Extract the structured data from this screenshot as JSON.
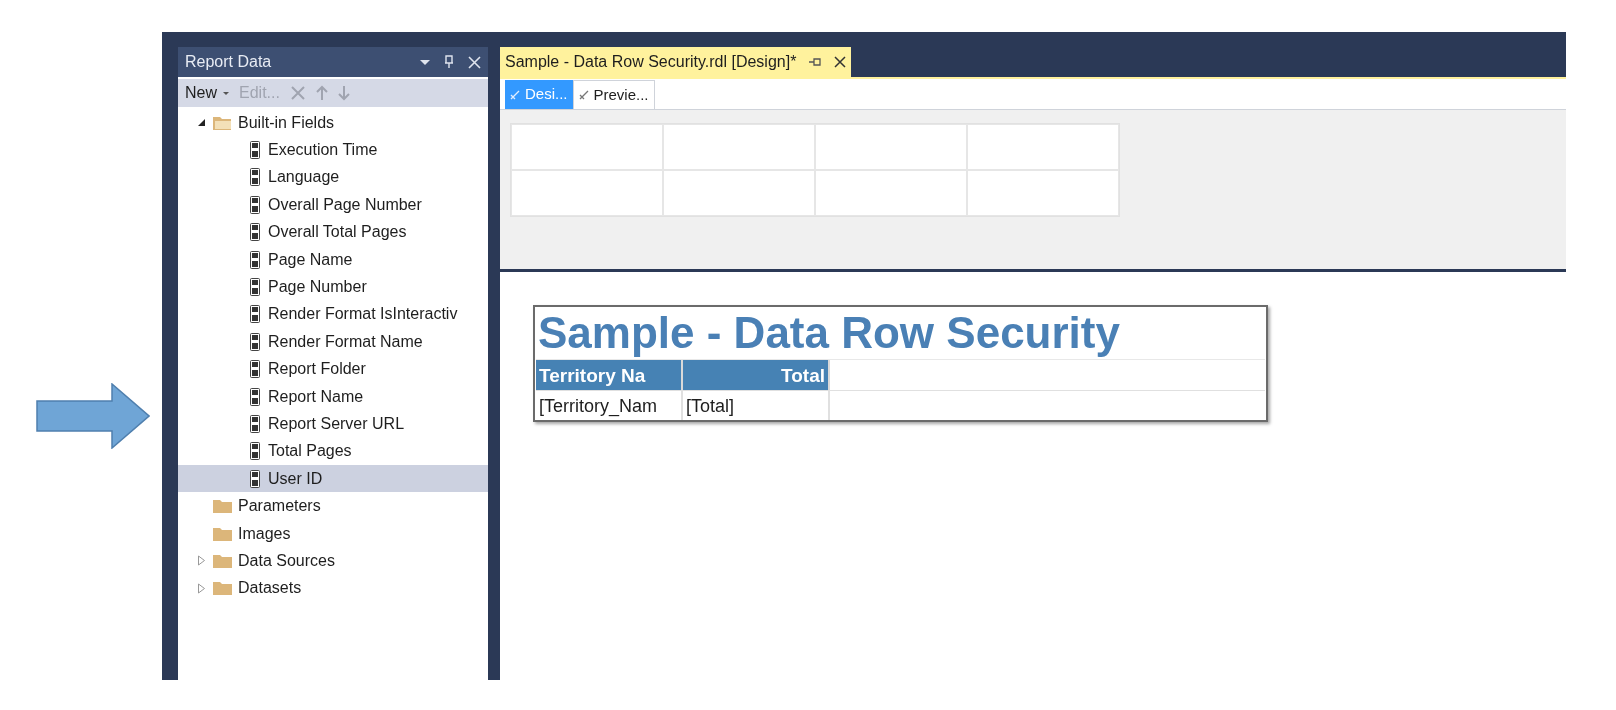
{
  "report_data_panel": {
    "title": "Report Data",
    "toolbar": [
      {
        "label": "New",
        "kind": "dropdown",
        "disabled": false
      },
      {
        "label": "Edit...",
        "kind": "text",
        "disabled": true
      },
      {
        "kind": "delete",
        "disabled": true
      },
      {
        "kind": "up",
        "disabled": true
      },
      {
        "kind": "down",
        "disabled": true
      }
    ],
    "tree": [
      {
        "label": "Built-in Fields",
        "kind": "folder",
        "expanded": true,
        "selected": false,
        "children": [
          {
            "label": "Execution Time",
            "kind": "field",
            "selected": false
          },
          {
            "label": "Language",
            "kind": "field",
            "selected": false
          },
          {
            "label": "Overall Page Number",
            "kind": "field",
            "selected": false
          },
          {
            "label": "Overall Total Pages",
            "kind": "field",
            "selected": false
          },
          {
            "label": "Page Name",
            "kind": "field",
            "selected": false
          },
          {
            "label": "Page Number",
            "kind": "field",
            "selected": false
          },
          {
            "label": "Render Format IsInteractiv",
            "kind": "field",
            "selected": false
          },
          {
            "label": "Render Format Name",
            "kind": "field",
            "selected": false
          },
          {
            "label": "Report Folder",
            "kind": "field",
            "selected": false
          },
          {
            "label": "Report Name",
            "kind": "field",
            "selected": false
          },
          {
            "label": "Report Server URL",
            "kind": "field",
            "selected": false
          },
          {
            "label": "Total Pages",
            "kind": "field",
            "selected": false
          },
          {
            "label": "User ID",
            "kind": "field",
            "selected": true
          }
        ]
      },
      {
        "label": "Parameters",
        "kind": "folder",
        "selected": false
      },
      {
        "label": "Images",
        "kind": "folder",
        "selected": false
      },
      {
        "label": "Data Sources",
        "kind": "folder",
        "expanded": false,
        "selected": false
      },
      {
        "label": "Datasets",
        "kind": "folder",
        "expanded": false,
        "selected": false
      }
    ]
  },
  "document_tab": {
    "title": "Sample - Data Row Security.rdl [Design]*"
  },
  "view_tabs": [
    {
      "label": "Desi...",
      "selected": true
    },
    {
      "label": "Previe...",
      "selected": false
    }
  ],
  "report": {
    "title": "Sample - Data Row Security",
    "columns": [
      "Territory Na",
      "Total"
    ],
    "rows": [
      [
        "[Territory_Nam",
        "[Total]"
      ]
    ]
  }
}
